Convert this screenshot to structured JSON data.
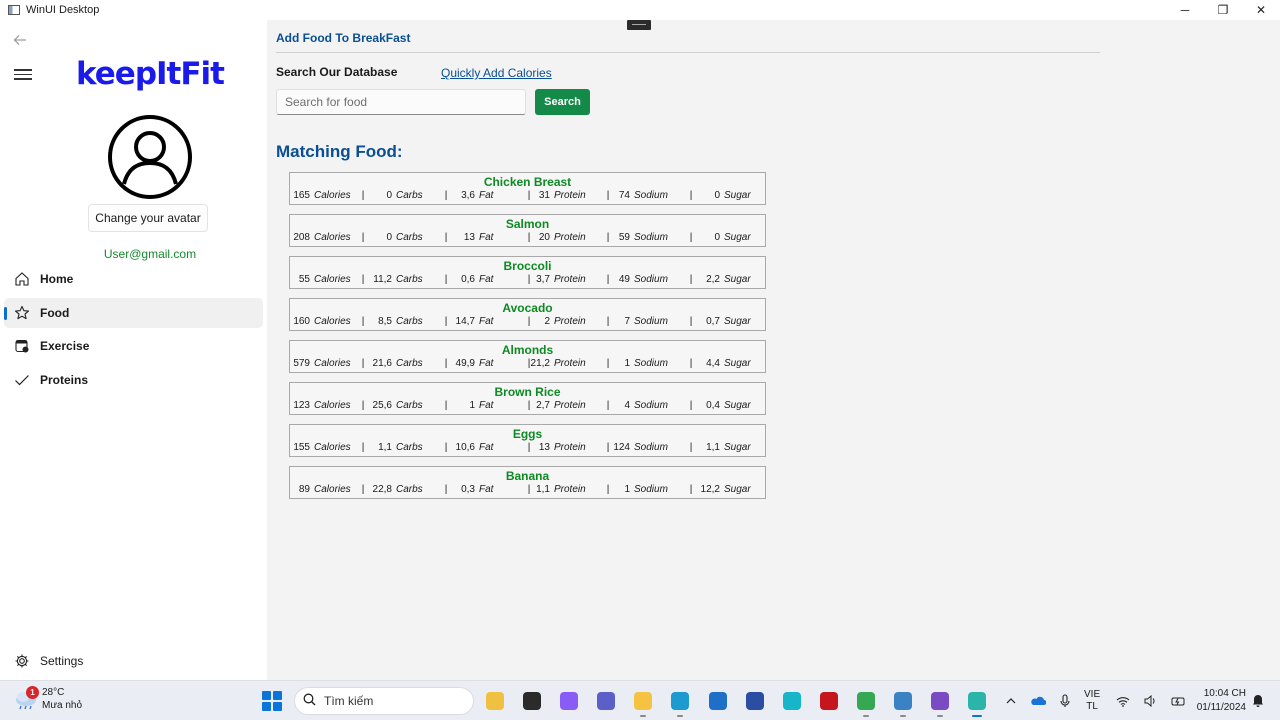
{
  "window": {
    "title": "WinUI Desktop",
    "controls": {
      "minimize": "─",
      "restore": "❐",
      "close": "✕"
    }
  },
  "sidebar": {
    "back_icon": "arrow-left-icon",
    "menu_icon": "hamburger-icon",
    "logo": "keepItFit",
    "avatar_icon": "user-circle-icon",
    "change_avatar_label": "Change your avatar",
    "user_email": "User@gmail.com",
    "items": [
      {
        "label": "Home",
        "icon": "home-icon",
        "active": false
      },
      {
        "label": "Food",
        "icon": "star-icon",
        "active": true
      },
      {
        "label": "Exercise",
        "icon": "exercise-icon",
        "active": false
      },
      {
        "label": "Proteins",
        "icon": "checkmark-icon",
        "active": false
      }
    ],
    "settings_label": "Settings",
    "settings_icon": "gear-icon"
  },
  "main": {
    "page_title": "Add Food To BreakFast",
    "search_label": "Search Our Database",
    "quick_add_link": "Quickly Add Calories",
    "search_placeholder": "Search for food",
    "search_button": "Search",
    "matching_title": "Matching Food:",
    "units": [
      "Calories",
      "Carbs",
      "Fat",
      "Protein",
      "Sodium",
      "Sugar"
    ],
    "separator": "|",
    "foods": [
      {
        "name": "Chicken Breast",
        "values": [
          "165",
          "0",
          "3,6",
          "31",
          "74",
          "0"
        ]
      },
      {
        "name": "Salmon",
        "values": [
          "208",
          "0",
          "13",
          "20",
          "59",
          "0"
        ]
      },
      {
        "name": "Broccoli",
        "values": [
          "55",
          "11,2",
          "0,6",
          "3,7",
          "49",
          "2,2"
        ]
      },
      {
        "name": "Avocado",
        "values": [
          "160",
          "8,5",
          "14,7",
          "2",
          "7",
          "0,7"
        ]
      },
      {
        "name": "Almonds",
        "values": [
          "579",
          "21,6",
          "49,9",
          "21,2",
          "1",
          "4,4"
        ]
      },
      {
        "name": "Brown Rice",
        "values": [
          "123",
          "25,6",
          "1",
          "2,7",
          "4",
          "0,4"
        ]
      },
      {
        "name": "Eggs",
        "values": [
          "155",
          "1,1",
          "10,6",
          "13",
          "124",
          "1,1"
        ]
      },
      {
        "name": "Banana",
        "values": [
          "89",
          "22,8",
          "0,3",
          "1,1",
          "1",
          "12,2"
        ]
      }
    ]
  },
  "taskbar": {
    "weather": {
      "temp": "28°C",
      "condition": "Mưa nhỏ",
      "badge": "1"
    },
    "search_placeholder": "Tìm kiếm",
    "apps": [
      {
        "name": "book-app-icon",
        "color": "#f0c040"
      },
      {
        "name": "terminal-icon",
        "color": "#2b2b2b"
      },
      {
        "name": "copilot-icon",
        "color": "#8a5cf6"
      },
      {
        "name": "teams-icon",
        "color": "#5b5fc7"
      },
      {
        "name": "file-explorer-icon",
        "color": "#f5c243"
      },
      {
        "name": "edge-icon",
        "color": "#1d9bd1"
      },
      {
        "name": "store-icon",
        "color": "#1f6fc9"
      },
      {
        "name": "visual-studio-code-icon",
        "color": "#2b4ea2"
      },
      {
        "name": "cyan-app-icon",
        "color": "#17b5c9"
      },
      {
        "name": "mcafee-icon",
        "color": "#c4161c"
      },
      {
        "name": "chrome-icon",
        "color": "#34a853"
      },
      {
        "name": "notepad-icon",
        "color": "#3b82c4"
      },
      {
        "name": "visual-studio-icon",
        "color": "#7b4bc4"
      },
      {
        "name": "winui-app-icon",
        "color": "#2bb5a8"
      }
    ],
    "tray": {
      "chevron": "^",
      "lang_top": "VIE",
      "lang_bottom": "TL"
    },
    "clock": {
      "time": "10:04 CH",
      "date": "01/11/2024"
    }
  }
}
